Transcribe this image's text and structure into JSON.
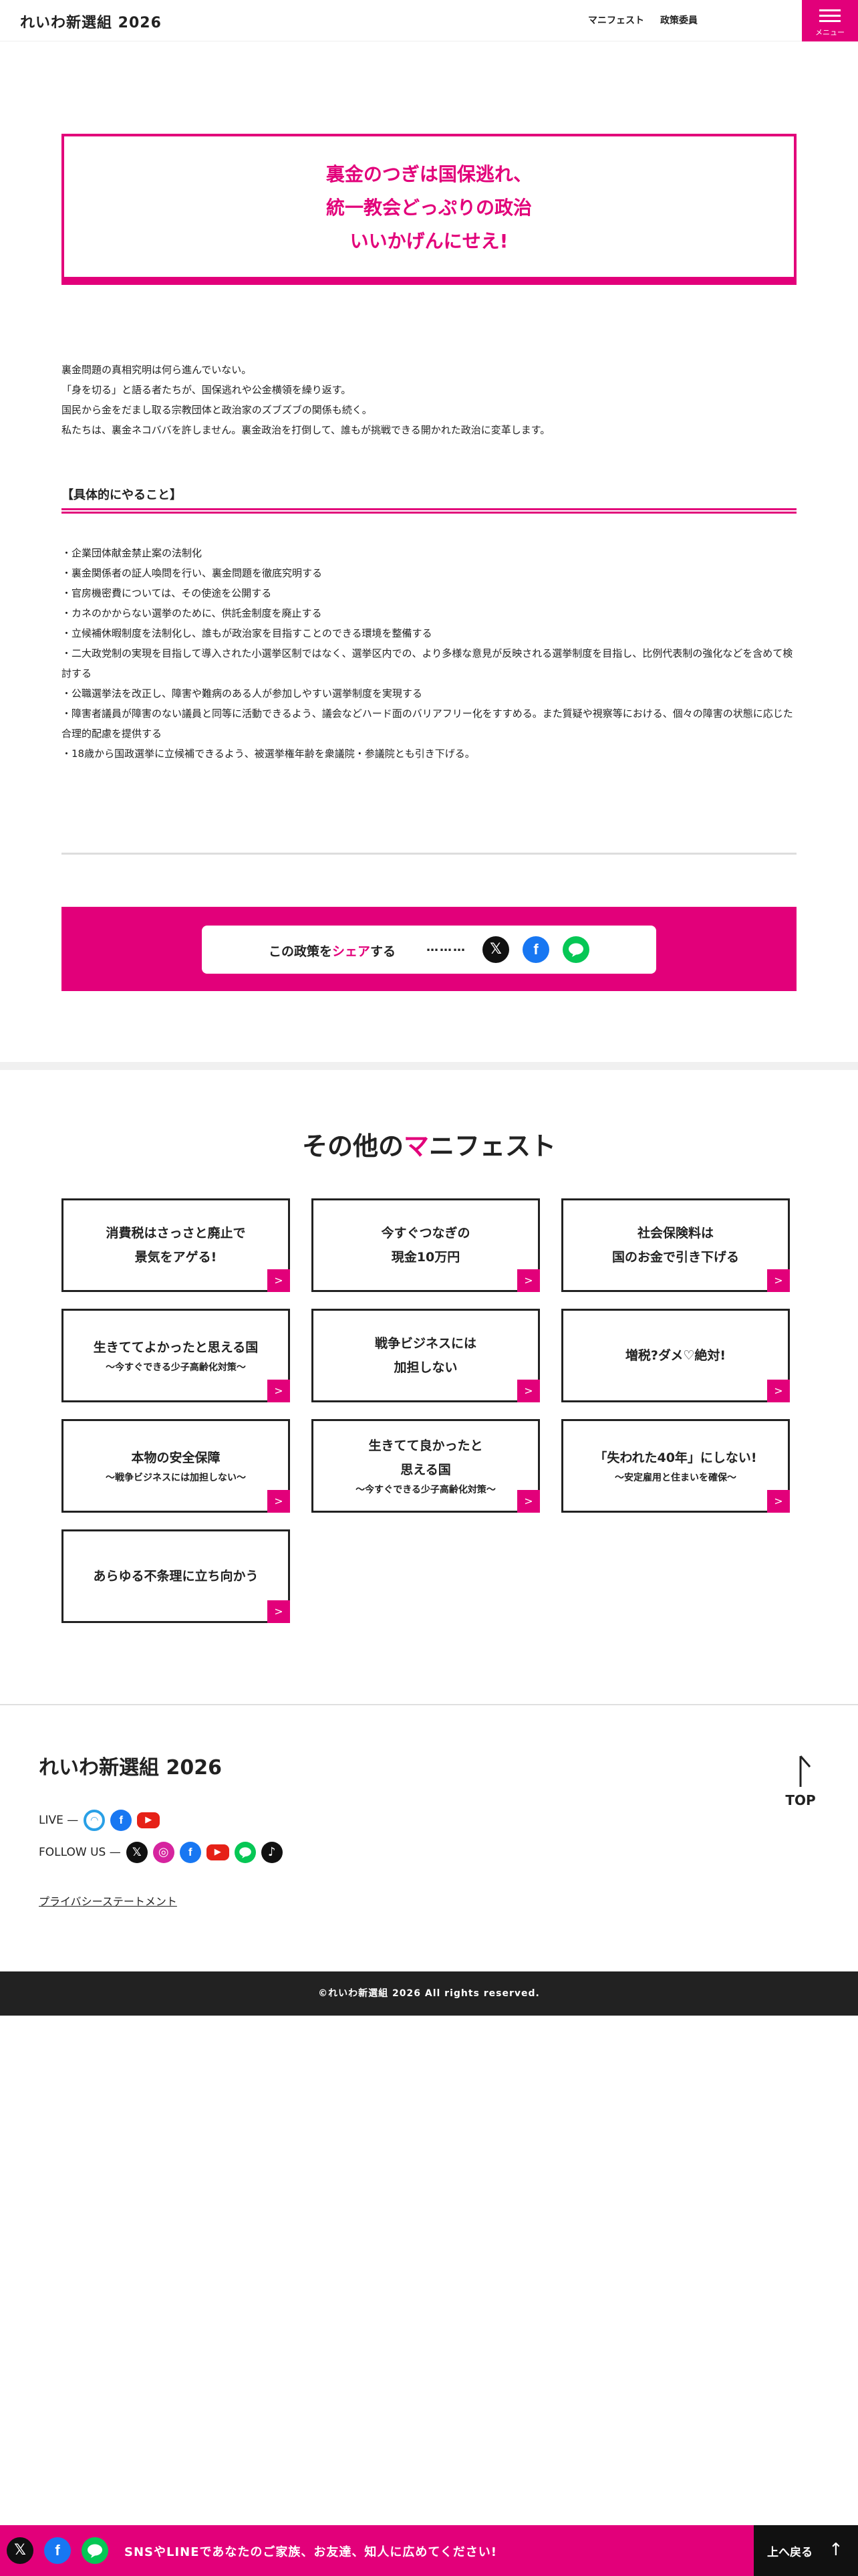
{
  "header": {
    "logo": "れいわ新選組 2026",
    "nav": [
      "マニフェスト",
      "政策委員"
    ],
    "menu_label": "メニュー"
  },
  "headline": [
    "裏金のつぎは国保逃れ、",
    "統一教会どっぷりの政治",
    "いいかげんにせえ!"
  ],
  "intro": [
    "裏金問題の真相究明は何ら進んでいない。",
    "「身を切る」と語る者たちが、国保逃れや公金横領を繰り返す。",
    "国民から金をだまし取る宗教団体と政治家のズブズブの関係も続く。",
    "私たちは、裏金ネコババを許しません。裏金政治を打倒して、誰もが挑戦できる開かれた政治に変革します。"
  ],
  "section_title": "【具体的にやること】",
  "policies": [
    "・企業団体献金禁止案の法制化",
    "・裏金関係者の証人喚問を行い、裏金問題を徹底究明する",
    "・官房機密費については、その使途を公開する",
    "・カネのかからない選挙のために、供託金制度を廃止する",
    "・立候補休暇制度を法制化し、誰もが政治家を目指すことのできる環境を整備する",
    "・二大政党制の実現を目指して導入された小選挙区制ではなく、選挙区内での、より多様な意見が反映される選挙制度を目指し、比例代表制の強化などを含めて検討する",
    "・公職選挙法を改正し、障害や難病のある人が参加しやすい選挙制度を実現する",
    "・障害者議員が障害のない議員と同等に活動できるよう、議会などハード面のバリアフリー化をすすめる。また質疑や視察等における、個々の障害の状態に応じた合理的配慮を提供する",
    "・18歳から国政選挙に立候補できるよう、被選挙権年齢を衆議院・参議院とも引き下げる。"
  ],
  "share": {
    "text_prefix": "この政策を",
    "text_highlight": "シェア",
    "text_suffix": "する",
    "dots": "………",
    "icons": [
      "x-icon",
      "facebook-icon",
      "line-icon"
    ]
  },
  "other": {
    "title_prefix": "その他の",
    "title_highlight": "マ",
    "title_suffix": "ニフェスト",
    "cards": [
      {
        "main": [
          "消費税はさっさと廃止で",
          "景気をアゲる!"
        ],
        "sub": ""
      },
      {
        "main": [
          "今すぐつなぎの",
          "現金10万円"
        ],
        "sub": ""
      },
      {
        "main": [
          "社会保険料は",
          "国のお金で引き下げる"
        ],
        "sub": ""
      },
      {
        "main": [
          "生きててよかったと思える国"
        ],
        "sub": "〜今すぐできる少子高齢化対策〜"
      },
      {
        "main": [
          "戦争ビジネスには",
          "加担しない"
        ],
        "sub": ""
      },
      {
        "main": [
          "増税?ダメ♡絶対!"
        ],
        "sub": ""
      },
      {
        "main": [
          "本物の安全保障"
        ],
        "sub": "〜戦争ビジネスには加担しない〜"
      },
      {
        "main": [
          "生きてて良かったと",
          "思える国"
        ],
        "sub": "〜今すぐできる少子高齢化対策〜"
      },
      {
        "main": [
          "「失われた40年」にしない!"
        ],
        "sub": "〜安定雇用と住まいを確保〜"
      },
      {
        "main": [
          "あらゆる不条理に立ち向かう"
        ],
        "sub": ""
      }
    ],
    "arrow": ">"
  },
  "footer": {
    "logo": "れいわ新選組 2026",
    "live_label": "LIVE —",
    "follow_label": "FOLLOW US —",
    "privacy": "プライバシーステートメント",
    "top_label": "TOP",
    "copyright": "©れいわ新選組 2026 All rights reserved."
  },
  "bottom_bar": {
    "text": "SNSやLINEであなたのご家族、お友達、知人に広めてください!",
    "back_label": "上へ戻る",
    "back_arrow": "↑"
  },
  "colors": {
    "accent": "#e2007a",
    "dark": "#222222"
  }
}
